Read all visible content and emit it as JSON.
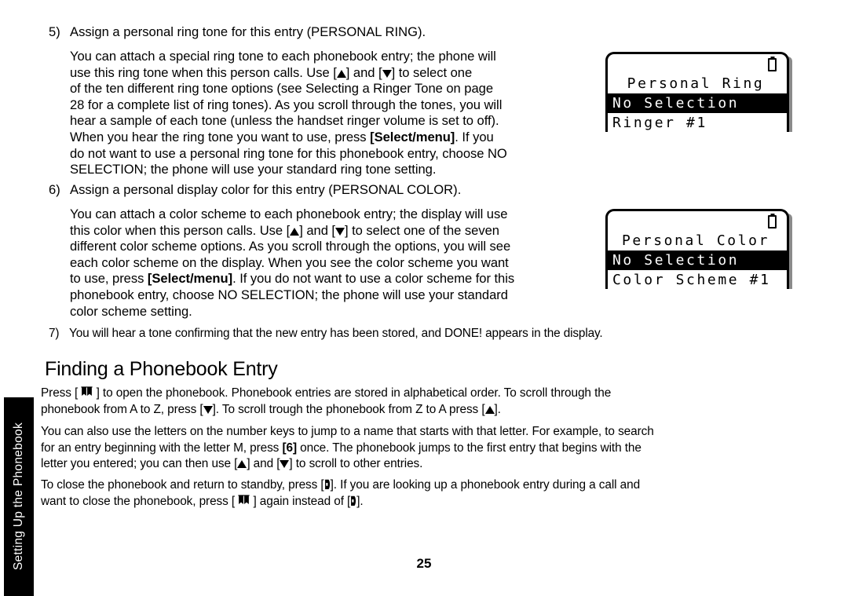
{
  "side_tab": {
    "label": "Setting Up the Phonebook"
  },
  "page_number": "25",
  "steps": [
    {
      "number": "5)",
      "heading": "Assign a personal ring tone for this entry (PERSONAL RING).",
      "body_lines": [
        "You can attach a special ring tone to each phonebook entry; the phone will",
        "use this ring tone when this person calls. Use [▲] and [▼] to select one",
        "of the ten different ring tone options (see Selecting a Ringer Tone on page",
        "28 for a complete list of ring tones). As you scroll through the tones, you will",
        "hear a sample of each tone (unless the handset ringer volume is set to off).",
        "When you hear the ring tone you want to use, press [Select/menu]. If you",
        "do not want to use a personal ring tone for this phonebook entry, choose NO",
        "SELECTION; the phone will use your standard ring tone setting."
      ]
    },
    {
      "number": "6)",
      "heading": "Assign a personal display color for this entry (PERSONAL COLOR).",
      "body_lines": [
        "You can attach a color scheme to each phonebook entry; the display will use",
        "this color when this person calls. Use [▲] and [▼] to select one of the seven",
        "different color scheme options. As you scroll through the options, you will see",
        "each color scheme on the display. When you see the color scheme you want",
        "to use, press [Select/menu]. If you do not want to use a color scheme for this",
        "phonebook entry, choose NO SELECTION; the phone will use your standard",
        "color scheme setting."
      ]
    },
    {
      "number": "7)",
      "heading": "You will hear a tone confirming that the new entry has been stored, and DONE! appears in the display."
    }
  ],
  "section": {
    "heading": "Finding a Phonebook Entry",
    "paragraphs": {
      "p1_a": "Press [",
      "p1_b": "] to open the phonebook. Phonebook entries are stored in alphabetical order. To scroll through the",
      "p1_c": "phonebook from A to Z, press [",
      "p1_d": "]. To scroll trough the phonebook from Z to A press [",
      "p1_e": "].",
      "p2_a": "You can also use the letters on the number keys to jump to a name that starts with that letter. For example, to search",
      "p2_b": "for an entry beginning with the letter M, press ",
      "p2_key": "[6]",
      "p2_c": " once. The phonebook jumps to the first entry that begins with the",
      "p2_d": "letter you entered; you can then use [",
      "p2_e": "] and [",
      "p2_f": "] to scroll to other entries.",
      "p3_a": "To close the phonebook and return to standby, press [",
      "p3_b": "]. If you are looking up a phonebook entry during a call and",
      "p3_c": "want to close the phonebook, press [ ",
      "p3_d": " ] again instead of [",
      "p3_e": "]."
    }
  },
  "lcd_screens": [
    {
      "name": "personal-ring",
      "title": "Personal Ring",
      "rows": [
        {
          "text": "No Selection",
          "selected": true
        },
        {
          "text": "Ringer #1",
          "selected": false
        }
      ],
      "battery_icon": "battery-full-icon"
    },
    {
      "name": "personal-color",
      "title": "Personal Color",
      "rows": [
        {
          "text": "No Selection",
          "selected": true
        },
        {
          "text": "Color Scheme #1",
          "selected": false
        }
      ],
      "battery_icon": "battery-full-icon"
    }
  ],
  "colors": {
    "ink": "#000000",
    "paper": "#ffffff",
    "tab_bg": "#000000",
    "tab_text": "#ffffff",
    "lcd_shadow": "#8a8a8a"
  }
}
